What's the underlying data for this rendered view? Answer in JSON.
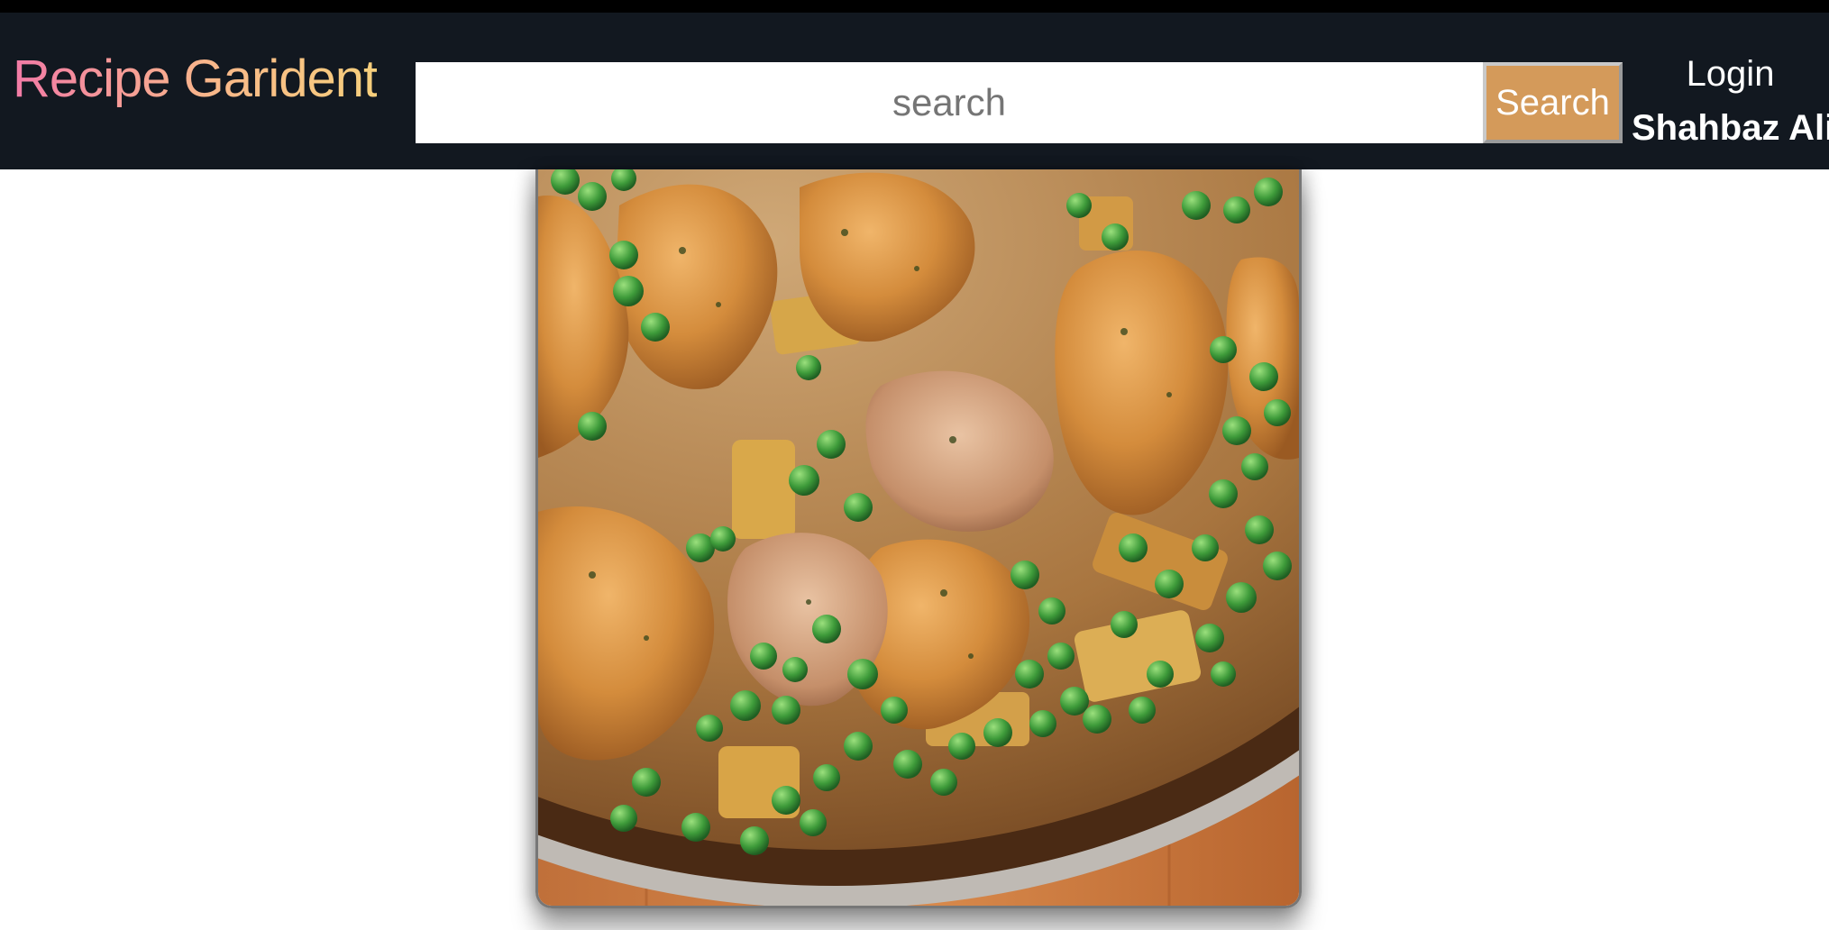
{
  "navbar": {
    "brand": "Recipe Garident",
    "search": {
      "placeholder": "search",
      "value": ""
    },
    "search_button": "Search",
    "login_label": "Login",
    "user_name": "Shahbaz Ali"
  },
  "recipe": {
    "image_subject": "chicken-with-peas-and-potatoes-in-pan"
  },
  "colors": {
    "navbar_bg": "#121820",
    "search_button_bg": "#d49a5a",
    "brand_gradient_start": "#f27aa6",
    "brand_gradient_end": "#f6cf7c"
  }
}
